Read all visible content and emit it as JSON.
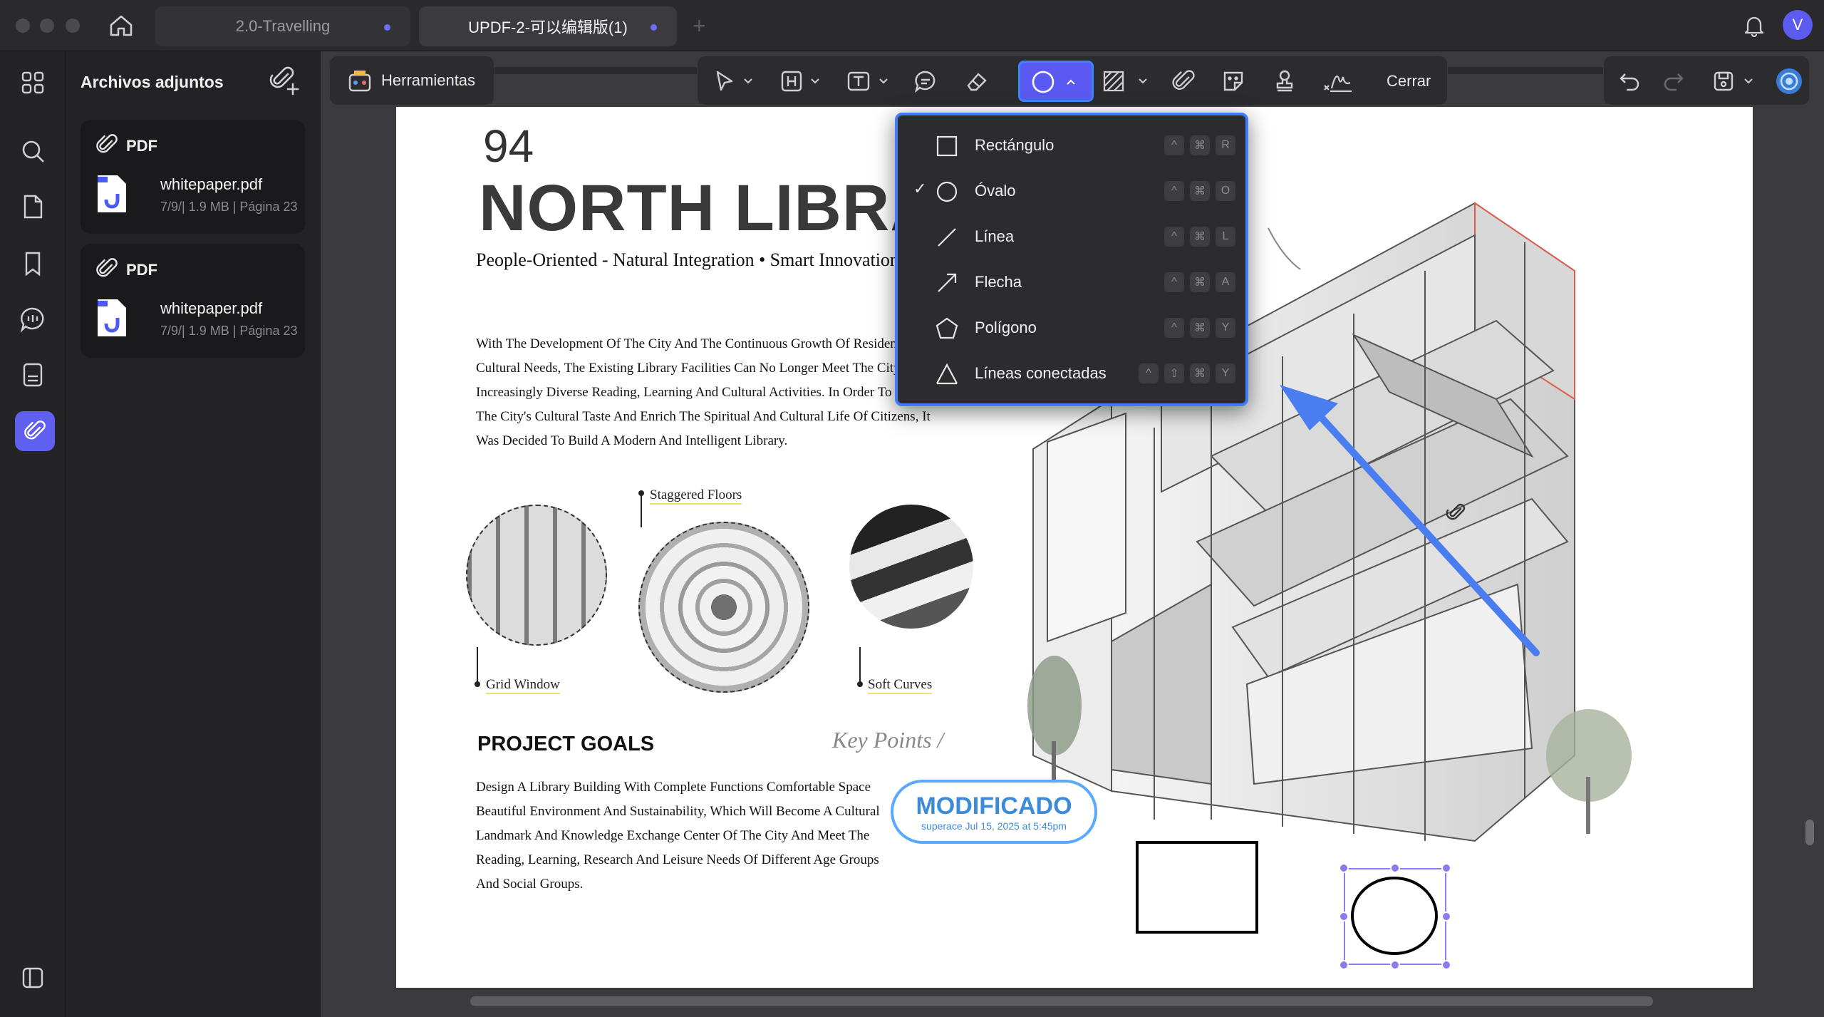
{
  "window": {
    "tabs": [
      {
        "label": "2.0-Travelling"
      },
      {
        "label": "UPDF-2-可以编辑版(1)"
      }
    ],
    "avatar_letter": "V"
  },
  "panel": {
    "title": "Archivos adjuntos",
    "attachments": [
      {
        "kind": "PDF",
        "filename": "whitepaper.pdf",
        "meta": "7/9/| 1.9 MB | Página 23"
      },
      {
        "kind": "PDF",
        "filename": "whitepaper.pdf",
        "meta": "7/9/| 1.9 MB | Página 23"
      }
    ]
  },
  "toolbar": {
    "tools_label": "Herramientas",
    "close_label": "Cerrar"
  },
  "shape_menu": {
    "items": [
      {
        "label": "Rectángulo",
        "checked": "",
        "keys": [
          "^",
          "⌘",
          "R"
        ]
      },
      {
        "label": "Óvalo",
        "checked": "✓",
        "keys": [
          "^",
          "⌘",
          "O"
        ]
      },
      {
        "label": "Línea",
        "checked": "",
        "keys": [
          "^",
          "⌘",
          "L"
        ]
      },
      {
        "label": "Flecha",
        "checked": "",
        "keys": [
          "^",
          "⌘",
          "A"
        ]
      },
      {
        "label": "Polígono",
        "checked": "",
        "keys": [
          "^",
          "⌘",
          "Y"
        ]
      },
      {
        "label": "Líneas conectadas",
        "checked": "",
        "keys": [
          "^",
          "⇧",
          "⌘",
          "Y"
        ]
      }
    ]
  },
  "document": {
    "page_number": "94",
    "title": "NORTH LIBRARY",
    "subtitle": "People-Oriented - Natural Integration • Smart Innovation",
    "intro_lines": [
      "With The Development Of The City And The Continuous Growth Of Residents'",
      "Cultural Needs, The Existing Library Facilities Can No Longer Meet The City's",
      "Increasingly Diverse Reading, Learning And Cultural Activities. In Order To Improve",
      "The City's Cultural Taste And Enrich The Spiritual And Cultural Life Of Citizens, It",
      "Was Decided To Build A Modern And Intelligent Library."
    ],
    "captions": {
      "staggered": "Staggered Floors",
      "grid": "Grid Window",
      "soft": "Soft Curves"
    },
    "goals_heading": "PROJECT GOALS",
    "key_points": "Key Points /",
    "goals_lines": [
      "Design A Library Building With Complete Functions Comfortable Space",
      "Beautiful Environment And Sustainability, Which Will Become A Cultural",
      "Landmark And Knowledge Exchange Center Of The City And Meet The",
      "Reading, Learning, Research And Leisure Needs Of Different Age Groups",
      "And Social Groups."
    ],
    "stamp": {
      "title": "MODIFICADO",
      "subtitle": "superace Jul 15, 2025 at 5:45pm"
    }
  },
  "colors": {
    "accent": "#5a5af2",
    "selection": "#3f7cf5",
    "arrow": "#4a7df0"
  }
}
